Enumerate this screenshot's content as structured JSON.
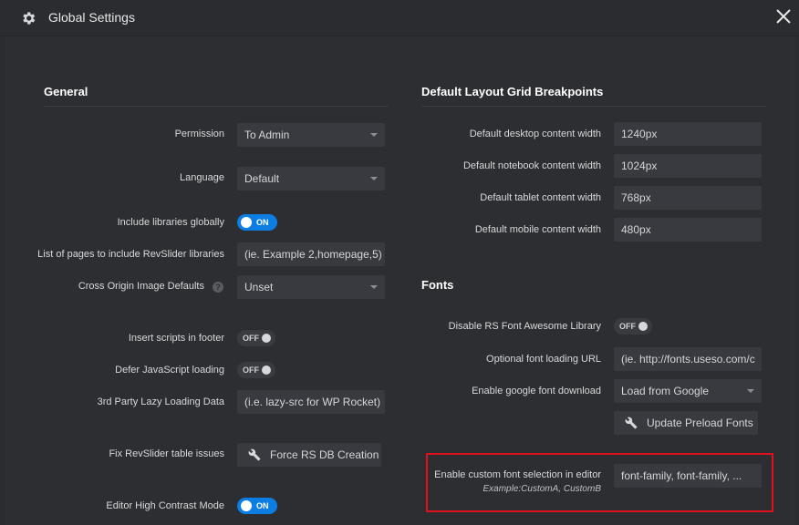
{
  "window": {
    "title": "Global Settings"
  },
  "general": {
    "title": "General",
    "permission": {
      "label": "Permission",
      "value": "To Admin"
    },
    "language": {
      "label": "Language",
      "value": "Default"
    },
    "include_libraries": {
      "label": "Include libraries globally",
      "state": "ON"
    },
    "pages_list": {
      "label": "List of pages to include RevSlider libraries",
      "placeholder": "(ie. Example 2,homepage,5)"
    },
    "cross_origin": {
      "label": "Cross Origin Image Defaults",
      "help": "?",
      "value": "Unset"
    },
    "insert_footer": {
      "label": "Insert scripts in footer",
      "state": "OFF"
    },
    "defer_js": {
      "label": "Defer JavaScript loading",
      "state": "OFF"
    },
    "lazy_loading": {
      "label": "3rd Party Lazy Loading Data",
      "placeholder": "(i.e. lazy-src for WP Rocket)"
    },
    "fix_tables": {
      "label": "Fix RevSlider table issues",
      "button": "Force RS DB Creation"
    },
    "high_contrast": {
      "label": "Editor High Contrast Mode",
      "state": "ON"
    }
  },
  "breakpoints": {
    "title": "Default Layout Grid Breakpoints",
    "desktop": {
      "label": "Default desktop content width",
      "value": "1240px"
    },
    "notebook": {
      "label": "Default notebook content width",
      "value": "1024px"
    },
    "tablet": {
      "label": "Default tablet content width",
      "value": "768px"
    },
    "mobile": {
      "label": "Default mobile content width",
      "value": "480px"
    }
  },
  "fonts": {
    "title": "Fonts",
    "disable_fa": {
      "label": "Disable RS Font Awesome Library",
      "state": "OFF"
    },
    "font_url": {
      "label": "Optional font loading URL",
      "placeholder": "(ie. http://fonts.useso.com/c"
    },
    "google_download": {
      "label": "Enable google font download",
      "value": "Load from Google"
    },
    "preload_button": "Update Preload Fonts",
    "custom_font": {
      "label": "Enable custom font selection in editor",
      "example": "Example:CustomA, CustomB",
      "placeholder": "font-family, font-family, ..."
    }
  },
  "colors": {
    "accent": "#0b7de3",
    "highlight": "#e0111f",
    "background": "#2d2e32",
    "field": "#393a3f"
  },
  "icons": {
    "settings": "gear-icon",
    "close": "close-icon",
    "wrench": "wrench-icon",
    "help": "help-icon"
  }
}
